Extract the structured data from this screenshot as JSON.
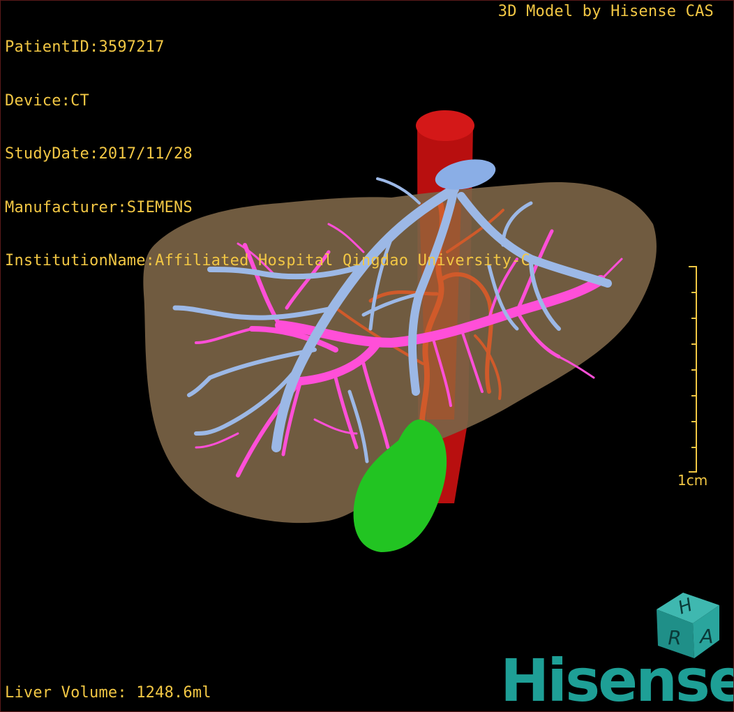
{
  "info": {
    "patient_id": "PatientID:3597217",
    "device": "Device:CT",
    "study_date": "StudyDate:2017/11/28",
    "manufacturer": "Manufacturer:SIEMENS",
    "institution": "InstitutionName:Affiliated Hospital Qingdao University-C"
  },
  "brand_line": "3D Model by Hisense CAS",
  "volume": "Liver Volume: 1248.6ml",
  "scale_label": "1cm",
  "cube_letters": {
    "top": "H",
    "left": "R",
    "right": "A"
  },
  "logo": "Hisense",
  "colors": {
    "overlay_text": "#f2c744",
    "liver": "#7a6345",
    "portal_vein": "#ff4fd8",
    "hepatic_vein": "#9cb8e6",
    "artery": "#d05a2a",
    "ivc": "#cc1010",
    "gallbladder": "#22c422",
    "brand": "#1e9f96"
  }
}
